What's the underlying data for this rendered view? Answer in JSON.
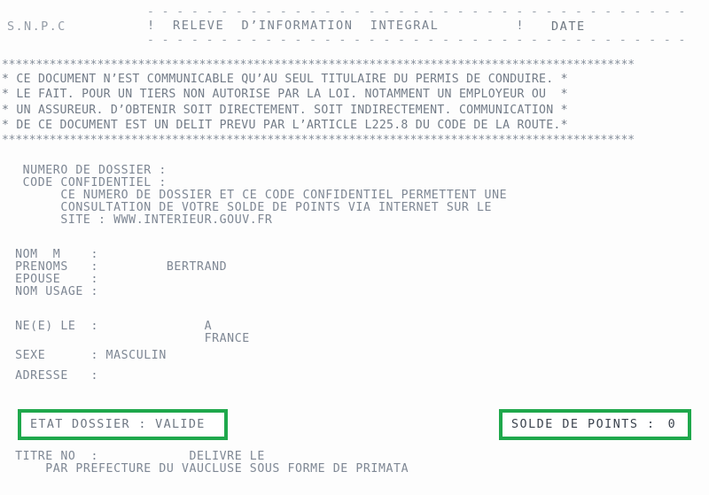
{
  "document": {
    "background_color": "#fdfdfd",
    "text_color": "#7e8794",
    "highlight_color": "#1fa84c"
  },
  "header": {
    "org_label": "S.N.P.C",
    "rule": "- - - - - - - - - - - - - - - - - - - - - - - - - - - - - - - - - - - - -",
    "title_line": "!  RELEVE  D’INFORMATION  INTEGRAL         !",
    "date_label": "DATE",
    "date_value": ""
  },
  "warning": {
    "star_rule": "*********************************************************************************************",
    "lines": [
      "* CE DOCUMENT N’EST COMMUNICABLE QU’AU SEUL TITULAIRE DU PERMIS DE CONDUIRE. *",
      "* LE FAIT. POUR UN TIERS NON AUTORISE PAR LA LOI. NOTAMMENT UN EMPLOYEUR OU  *",
      "* UN ASSUREUR. D’OBTENIR SOIT DIRECTEMENT. SOIT INDIRECTEMENT. COMMUNICATION *",
      "* DE CE DOCUMENT EST UN DELIT PREVU PAR L’ARTICLE L225.8 DU CODE DE LA ROUTE.*"
    ]
  },
  "dossier": {
    "numero_line": "   NUMERO DE DOSSIER :",
    "code_line": "   CODE CONFIDENTIEL :",
    "note_line_1": "        CE NUMERO DE DOSSIER ET CE CODE CONFIDENTIEL PERMETTENT UNE",
    "note_line_2": "        CONSULTATION DE VOTRE SOLDE DE POINTS VIA INTERNET SUR LE",
    "note_line_3": "        SITE : WWW.INTERIEUR.GOUV.FR"
  },
  "identity": {
    "nom_line": "  NOM  M    :",
    "prenoms_line": "  PRENOMS   :         BERTRAND",
    "epouse_line": "  EPOUSE    :",
    "nom_usage_line": "  NOM USAGE :"
  },
  "birth": {
    "ne_le_line": "  NE(E) LE  :              A",
    "pays_line": "                           FRANCE",
    "sexe_line": "  SEXE      : MASCULIN",
    "adresse_line": "  ADRESSE   :"
  },
  "status": {
    "etat_dossier_text": "ETAT DOSSIER : VALIDE",
    "solde_points_label": "SOLDE DE POINTS :",
    "solde_points_value": "0"
  },
  "footer": {
    "titre_line": "  TITRE NO  :            DELIVRE LE",
    "prefecture_line": "      PAR PREFECTURE DU VAUCLUSE SOUS FORME DE PRIMATA"
  }
}
